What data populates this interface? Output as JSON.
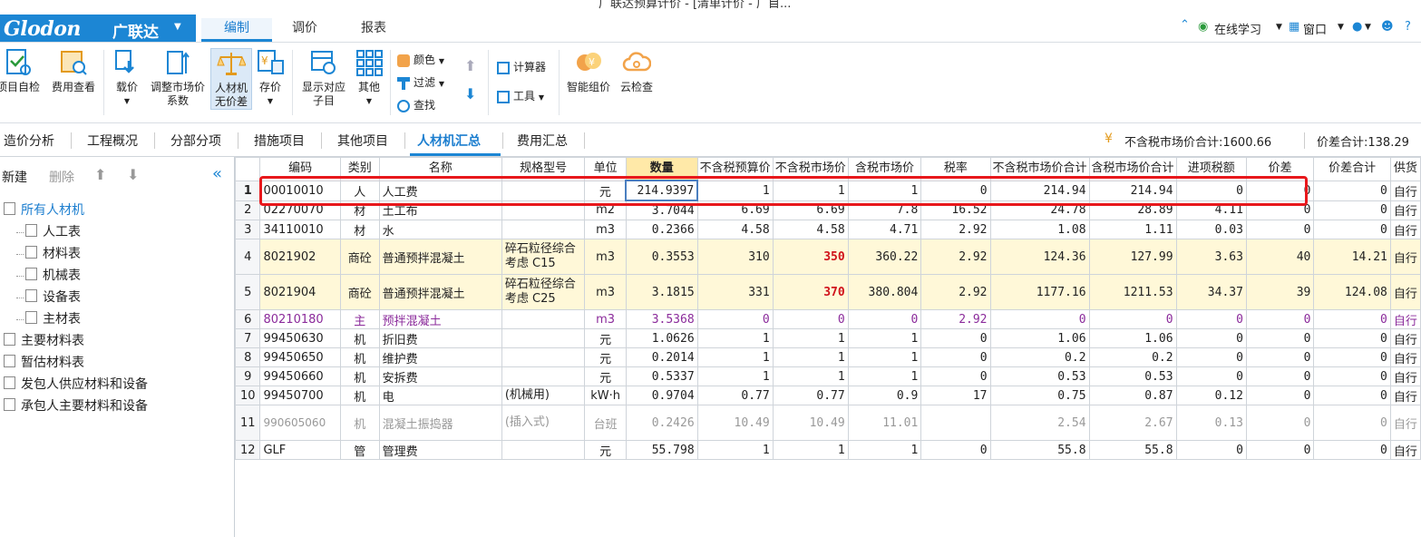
{
  "window_title": "广联达预算计价 - [清单计价 - 广目...",
  "app": {
    "brand": "Glodon",
    "brand_cn": "广联达"
  },
  "menu_tabs": [
    "编制",
    "调价",
    "报表"
  ],
  "right_menu": {
    "online": "在线学习",
    "window": "窗口"
  },
  "ribbon": {
    "check": "项目自检",
    "fee_view": "费用查看",
    "price_load": "载价",
    "adjust_1": "调整市场价",
    "adjust_2": "系数",
    "rcj_1": "人材机",
    "rcj_2": "无价差",
    "save_price": "存价",
    "show_sub_1": "显示对应",
    "show_sub_2": "子目",
    "other": "其他",
    "color": "颜色",
    "filter": "过滤",
    "find": "查找",
    "calculator": "计算器",
    "tools": "工具",
    "smart_price": "智能组价",
    "cloud_check": "云检查"
  },
  "sub_tabs": [
    "造价分析",
    "工程概况",
    "分部分项",
    "措施项目",
    "其他项目",
    "人材机汇总",
    "费用汇总"
  ],
  "totals": {
    "market_total": "不含税市场价合计:1600.66",
    "diff_total": "价差合计:138.29"
  },
  "left_panel": {
    "new": "新建",
    "delete": "删除",
    "tree": [
      {
        "label": "所有人材机",
        "level": 0,
        "active": true
      },
      {
        "label": "人工表",
        "level": 1
      },
      {
        "label": "材料表",
        "level": 1
      },
      {
        "label": "机械表",
        "level": 1
      },
      {
        "label": "设备表",
        "level": 1
      },
      {
        "label": "主材表",
        "level": 1
      },
      {
        "label": "主要材料表",
        "level": 0
      },
      {
        "label": "暂估材料表",
        "level": 0
      },
      {
        "label": "发包人供应材料和设备",
        "level": 0
      },
      {
        "label": "承包人主要材料和设备",
        "level": 0
      }
    ]
  },
  "table": {
    "headers": [
      "编码",
      "类别",
      "名称",
      "规格型号",
      "单位",
      "数量",
      "不含税预算价",
      "不含税市场价",
      "含税市场价",
      "税率",
      "不含税市场价合计",
      "含税市场价合计",
      "进项税额",
      "价差",
      "价差合计",
      "供货"
    ],
    "rows": [
      {
        "n": "1",
        "code": "00010010",
        "type": "人",
        "name": "人工费",
        "spec": "",
        "unit": "元",
        "qty": "214.9397",
        "budget": "1",
        "market": "1",
        "tax_market": "1",
        "rate": "0",
        "market_sum": "214.94",
        "tax_sum": "214.94",
        "input_tax": "0",
        "diff": "0",
        "diff_sum": "0",
        "supply": "自行",
        "style": ""
      },
      {
        "n": "2",
        "code": "02270070",
        "type": "材",
        "name": "土工布",
        "spec": "",
        "unit": "m2",
        "qty": "3.7044",
        "budget": "6.69",
        "market": "6.69",
        "tax_market": "7.8",
        "rate": "16.52",
        "market_sum": "24.78",
        "tax_sum": "28.89",
        "input_tax": "4.11",
        "diff": "0",
        "diff_sum": "0",
        "supply": "自行",
        "style": ""
      },
      {
        "n": "3",
        "code": "34110010",
        "type": "材",
        "name": "水",
        "spec": "",
        "unit": "m3",
        "qty": "0.2366",
        "budget": "4.58",
        "market": "4.58",
        "tax_market": "4.71",
        "rate": "2.92",
        "market_sum": "1.08",
        "tax_sum": "1.11",
        "input_tax": "0.03",
        "diff": "0",
        "diff_sum": "0",
        "supply": "自行",
        "style": ""
      },
      {
        "n": "4",
        "code": "8021902",
        "type": "商砼",
        "name": "普通预拌混凝土",
        "spec": "碎石粒径综合考虑 C15",
        "unit": "m3",
        "qty": "0.3553",
        "budget": "310",
        "market": "350",
        "tax_market": "360.22",
        "rate": "2.92",
        "market_sum": "124.36",
        "tax_sum": "127.99",
        "input_tax": "3.63",
        "diff": "40",
        "diff_sum": "14.21",
        "supply": "自行",
        "style": "yellow tall"
      },
      {
        "n": "5",
        "code": "8021904",
        "type": "商砼",
        "name": "普通预拌混凝土",
        "spec": "碎石粒径综合考虑 C25",
        "unit": "m3",
        "qty": "3.1815",
        "budget": "331",
        "market": "370",
        "tax_market": "380.804",
        "rate": "2.92",
        "market_sum": "1177.16",
        "tax_sum": "1211.53",
        "input_tax": "34.37",
        "diff": "39",
        "diff_sum": "124.08",
        "supply": "自行",
        "style": "yellow tall"
      },
      {
        "n": "6",
        "code": "80210180",
        "type": "主",
        "name": "预拌混凝土",
        "spec": "",
        "unit": "m3",
        "qty": "3.5368",
        "budget": "0",
        "market": "0",
        "tax_market": "0",
        "rate": "2.92",
        "market_sum": "0",
        "tax_sum": "0",
        "input_tax": "0",
        "diff": "0",
        "diff_sum": "0",
        "supply": "自行",
        "style": "purple"
      },
      {
        "n": "7",
        "code": "99450630",
        "type": "机",
        "name": "折旧费",
        "spec": "",
        "unit": "元",
        "qty": "1.0626",
        "budget": "1",
        "market": "1",
        "tax_market": "1",
        "rate": "0",
        "market_sum": "1.06",
        "tax_sum": "1.06",
        "input_tax": "0",
        "diff": "0",
        "diff_sum": "0",
        "supply": "自行",
        "style": ""
      },
      {
        "n": "8",
        "code": "99450650",
        "type": "机",
        "name": "维护费",
        "spec": "",
        "unit": "元",
        "qty": "0.2014",
        "budget": "1",
        "market": "1",
        "tax_market": "1",
        "rate": "0",
        "market_sum": "0.2",
        "tax_sum": "0.2",
        "input_tax": "0",
        "diff": "0",
        "diff_sum": "0",
        "supply": "自行",
        "style": ""
      },
      {
        "n": "9",
        "code": "99450660",
        "type": "机",
        "name": "安拆费",
        "spec": "",
        "unit": "元",
        "qty": "0.5337",
        "budget": "1",
        "market": "1",
        "tax_market": "1",
        "rate": "0",
        "market_sum": "0.53",
        "tax_sum": "0.53",
        "input_tax": "0",
        "diff": "0",
        "diff_sum": "0",
        "supply": "自行",
        "style": ""
      },
      {
        "n": "10",
        "code": "99450700",
        "type": "机",
        "name": "电",
        "spec": "(机械用)",
        "unit": "kW·h",
        "qty": "0.9704",
        "budget": "0.77",
        "market": "0.77",
        "tax_market": "0.9",
        "rate": "17",
        "market_sum": "0.75",
        "tax_sum": "0.87",
        "input_tax": "0.12",
        "diff": "0",
        "diff_sum": "0",
        "supply": "自行",
        "style": ""
      },
      {
        "n": "11",
        "code": "990605060",
        "type": "机",
        "name": "混凝土振捣器",
        "spec": "(插入式)",
        "unit": "台班",
        "qty": "0.2426",
        "budget": "10.49",
        "market": "10.49",
        "tax_market": "11.01",
        "rate": "",
        "market_sum": "2.54",
        "tax_sum": "2.67",
        "input_tax": "0.13",
        "diff": "0",
        "diff_sum": "0",
        "supply": "自行",
        "style": "gray tall"
      },
      {
        "n": "12",
        "code": "GLF",
        "type": "管",
        "name": "管理费",
        "spec": "",
        "unit": "元",
        "qty": "55.798",
        "budget": "1",
        "market": "1",
        "tax_market": "1",
        "rate": "0",
        "market_sum": "55.8",
        "tax_sum": "55.8",
        "input_tax": "0",
        "diff": "0",
        "diff_sum": "0",
        "supply": "自行",
        "style": ""
      }
    ]
  },
  "colors": {
    "brand": "#1c86d4",
    "highlight": "#e8181c",
    "price_red": "#d0121b",
    "main_material": "#8b2b9b"
  }
}
